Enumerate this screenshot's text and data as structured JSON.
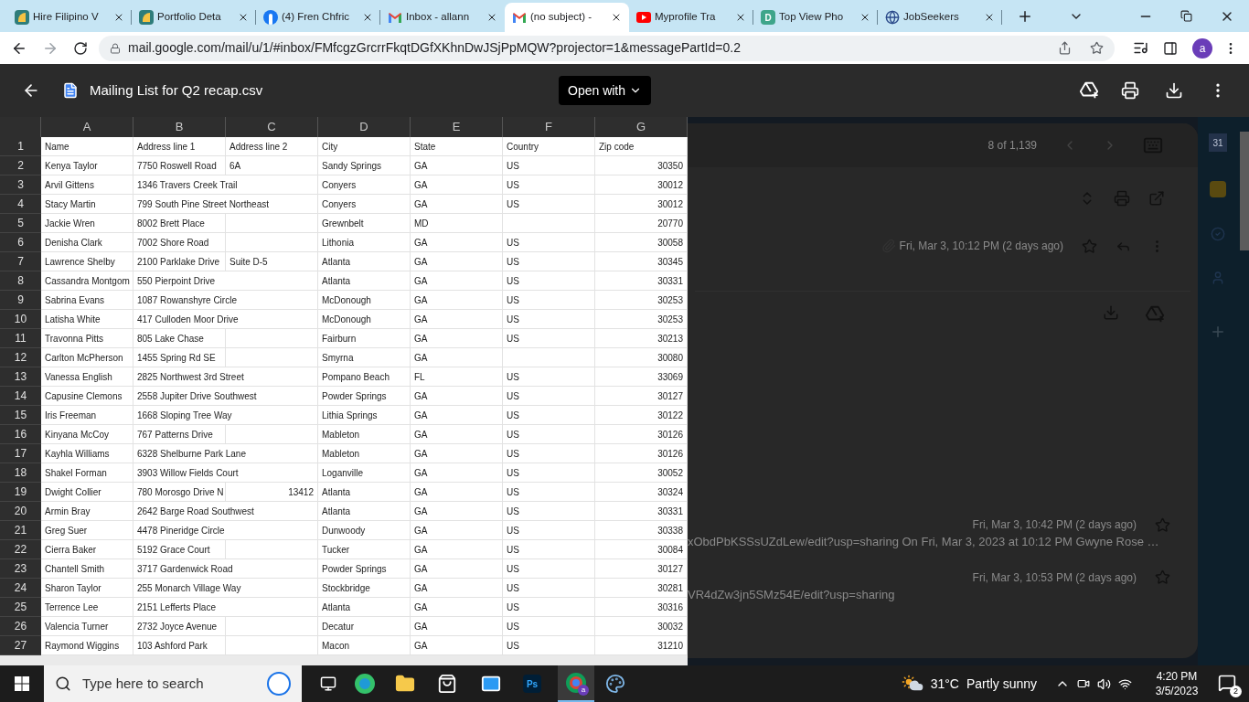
{
  "browser": {
    "tabs": [
      {
        "title": "Hire Filipino V",
        "kind": "leaf",
        "selected": false
      },
      {
        "title": "Portfolio Deta",
        "kind": "leaf",
        "selected": false
      },
      {
        "title": "(4) Fren Chfric",
        "kind": "facebook",
        "selected": false
      },
      {
        "title": "Inbox - allann",
        "kind": "gmail",
        "selected": false
      },
      {
        "title": "(no subject) -",
        "kind": "gmail",
        "selected": true
      },
      {
        "title": "Myprofile Tra",
        "kind": "youtube",
        "selected": false
      },
      {
        "title": "Top View Pho",
        "kind": "letter",
        "selected": false
      },
      {
        "title": "JobSeekers",
        "kind": "globe",
        "selected": false
      }
    ],
    "tab_letter": "D",
    "url": "mail.google.com/mail/u/1/#inbox/FMfcgzGrcrrFkqtDGfXKhnDwJSjPpMQW?projector=1&messagePartId=0.2",
    "profile": "a"
  },
  "viewer": {
    "title": "Mailing List for Q2 recap.csv",
    "open_with": "Open with"
  },
  "sheet": {
    "columns": [
      "A",
      "B",
      "C",
      "D",
      "E",
      "F",
      "G"
    ],
    "rows": [
      {
        "number": "1",
        "cells": [
          "Name",
          "Address line 1",
          "Address line 2",
          "City",
          "State",
          "Country",
          "Zip code"
        ]
      },
      {
        "number": "2",
        "cells": [
          "Kenya Taylor",
          "7750 Roswell Road",
          "6A",
          "Sandy Springs",
          "GA",
          "US",
          "30350"
        ]
      },
      {
        "number": "3",
        "cells": [
          "Arvil Gittens",
          "1346 Travers Creek Trail",
          null,
          "Conyers",
          "GA",
          "US",
          "30012"
        ]
      },
      {
        "number": "4",
        "cells": [
          "Stacy Martin",
          "799 South Pine Street Northeast",
          null,
          "Conyers",
          "GA",
          "US",
          "30012"
        ]
      },
      {
        "number": "5",
        "cells": [
          "Jackie Wren",
          "8002 Brett Place",
          null,
          "Grewnbelt",
          "MD",
          null,
          "20770"
        ]
      },
      {
        "number": "6",
        "cells": [
          "Denisha Clark",
          "7002 Shore Road",
          null,
          "Lithonia",
          "GA",
          "US",
          "30058"
        ]
      },
      {
        "number": "7",
        "cells": [
          "Lawrence Shelby",
          "2100 Parklake Drive",
          "Suite D-5",
          "Atlanta",
          "GA",
          "US",
          "30345"
        ]
      },
      {
        "number": "8",
        "cells": [
          "Cassandra Montgom",
          "550 Pierpoint Drive",
          null,
          "Atlanta",
          "GA",
          "US",
          "30331"
        ]
      },
      {
        "number": "9",
        "cells": [
          "Sabrina Evans",
          "1087 Rowanshyre Circle",
          null,
          "McDonough",
          "GA",
          "US",
          "30253"
        ]
      },
      {
        "number": "10",
        "cells": [
          "Latisha White",
          "417 Culloden Moor Drive",
          null,
          "McDonough",
          "GA",
          "US",
          "30253"
        ]
      },
      {
        "number": "11",
        "cells": [
          "Travonna Pitts",
          "805 Lake Chase",
          null,
          "Fairburn",
          "GA",
          "US",
          "30213"
        ]
      },
      {
        "number": "12",
        "cells": [
          "Carlton McPherson",
          "1455 Spring Rd SE",
          null,
          "Smyrna",
          "GA",
          null,
          "30080"
        ]
      },
      {
        "number": "13",
        "cells": [
          "Vanessa English",
          "2825 Northwest 3rd Street",
          null,
          "Pompano Beach",
          "FL",
          "US",
          "33069"
        ]
      },
      {
        "number": "14",
        "cells": [
          "Capusine Clemons",
          "2558 Jupiter Drive Southwest",
          null,
          "Powder Springs",
          "GA",
          "US",
          "30127"
        ]
      },
      {
        "number": "15",
        "cells": [
          "Iris Freeman",
          "1668 Sloping Tree Way",
          null,
          "Lithia Springs",
          "GA",
          "US",
          "30122"
        ]
      },
      {
        "number": "16",
        "cells": [
          "Kinyana McCoy",
          "767 Patterns Drive",
          null,
          "Mableton",
          "GA",
          "US",
          "30126"
        ]
      },
      {
        "number": "17",
        "cells": [
          "Kayhla Williams",
          "6328 Shelburne Park Lane",
          null,
          "Mableton",
          "GA",
          "US",
          "30126"
        ]
      },
      {
        "number": "18",
        "cells": [
          "Shakel Forman",
          "3903 Willow Fields Court",
          null,
          "Loganville",
          "GA",
          "US",
          "30052"
        ]
      },
      {
        "number": "19",
        "cells": [
          "Dwight Collier",
          "780 Morosgo Drive N",
          "13412",
          "Atlanta",
          "GA",
          "US",
          "30324"
        ]
      },
      {
        "number": "20",
        "cells": [
          "Armin Bray",
          "2642 Barge Road Southwest",
          null,
          "Atlanta",
          "GA",
          "US",
          "30331"
        ]
      },
      {
        "number": "21",
        "cells": [
          "Greg Suer",
          "4478 Pineridge Circle",
          null,
          "Dunwoody",
          "GA",
          "US",
          "30338"
        ]
      },
      {
        "number": "22",
        "cells": [
          "Cierra Baker",
          "5192 Grace Court",
          null,
          "Tucker",
          "GA",
          "US",
          "30084"
        ]
      },
      {
        "number": "23",
        "cells": [
          "Chantell Smith",
          "3717 Gardenwick Road",
          null,
          "Powder Springs",
          "GA",
          "US",
          "30127"
        ]
      },
      {
        "number": "24",
        "cells": [
          "Sharon Taylor",
          "255 Monarch Village Way",
          null,
          "Stockbridge",
          "GA",
          "US",
          "30281"
        ]
      },
      {
        "number": "25",
        "cells": [
          "Terrence Lee",
          "2151 Lefferts Place",
          null,
          "Atlanta",
          "GA",
          "US",
          "30316"
        ]
      },
      {
        "number": "26",
        "cells": [
          "Valencia Turner",
          "2732 Joyce Avenue",
          null,
          "Decatur",
          "GA",
          "US",
          "30032"
        ]
      },
      {
        "number": "27",
        "cells": [
          "Raymond Wiggins",
          "103 Ashford Park",
          null,
          "Macon",
          "GA",
          "US",
          "31210"
        ]
      }
    ]
  },
  "gmail_background": {
    "counter": "8 of 1,139",
    "first_date": "Fri, Mar 3, 10:12 PM (2 days ago)",
    "calendar_day": "31",
    "messages": [
      {
        "date": "Fri, Mar 3, 10:42 PM (2 days ago)",
        "snippet": "xObdPbKSSsUZdLew/edit?usp=sharing On Fri, Mar 3, 2023 at 10:12 PM Gwyne Rose …"
      },
      {
        "date": "Fri, Mar 3, 10:53 PM (2 days ago)",
        "snippet": "VR4dZw3jn5SMz54E/edit?usp=sharing"
      }
    ]
  },
  "taskbar": {
    "search_placeholder": "Type here to search",
    "photoshop_label": "Ps",
    "chrome_badge": "a",
    "temperature": "31°C",
    "weather": "Partly sunny",
    "time": "4:20 PM",
    "date": "3/5/2023",
    "notifications": "2"
  }
}
